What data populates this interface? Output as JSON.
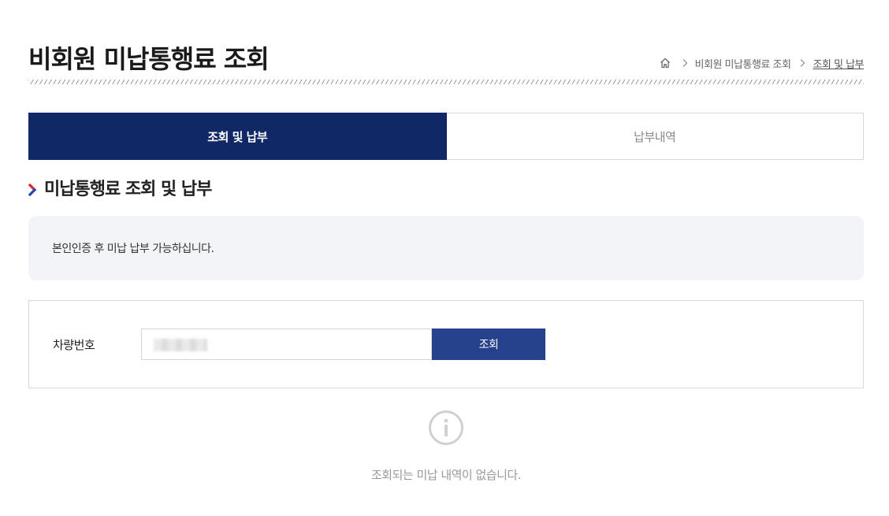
{
  "header": {
    "title": "비회원 미납통행료 조회"
  },
  "breadcrumb": {
    "home_icon": "home-icon",
    "items": [
      "비회원 미납통행료 조회",
      "조회 및 납부"
    ]
  },
  "tabs": [
    {
      "label": "조회 및 납부",
      "active": true
    },
    {
      "label": "납부내역",
      "active": false
    }
  ],
  "section": {
    "title": "미납통행료 조회 및 납부"
  },
  "notice": {
    "text": "본인인증 후 미납 납부 가능하십니다."
  },
  "search": {
    "label": "차량번호",
    "button_label": "조회"
  },
  "empty_state": {
    "icon": "info-icon",
    "message": "조회되는 미납 내역이 없습니다."
  },
  "colors": {
    "primary_navy": "#102866",
    "button_blue": "#27428c",
    "accent_red": "#e0242d",
    "accent_blue": "#1f4aa8"
  }
}
